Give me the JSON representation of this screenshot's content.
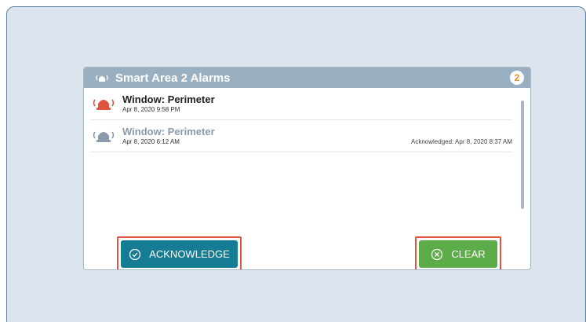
{
  "panel": {
    "title": "Smart Area 2 Alarms",
    "badge_count": "2"
  },
  "alarms": [
    {
      "name": "Window: Perimeter",
      "time": "Apr 8, 2020 9:58 PM",
      "acknowledged": "",
      "state": "active",
      "icon": "alarm-siren-icon"
    },
    {
      "name": "Window: Perimeter",
      "time": "Apr 8, 2020 6:12 AM",
      "acknowledged": "Acknowledged: Apr 8, 2020 8:37 AM",
      "state": "acknowledged",
      "icon": "alarm-siren-icon"
    }
  ],
  "actions": {
    "acknowledge_label": "ACKNOWLEDGE",
    "clear_label": "CLEAR"
  },
  "colors": {
    "active_alarm": "#e0533c",
    "acknowledge_button": "#157c93",
    "clear_button": "#5cad4a",
    "badge_text": "#f08c1e",
    "header": "#99afc2"
  }
}
